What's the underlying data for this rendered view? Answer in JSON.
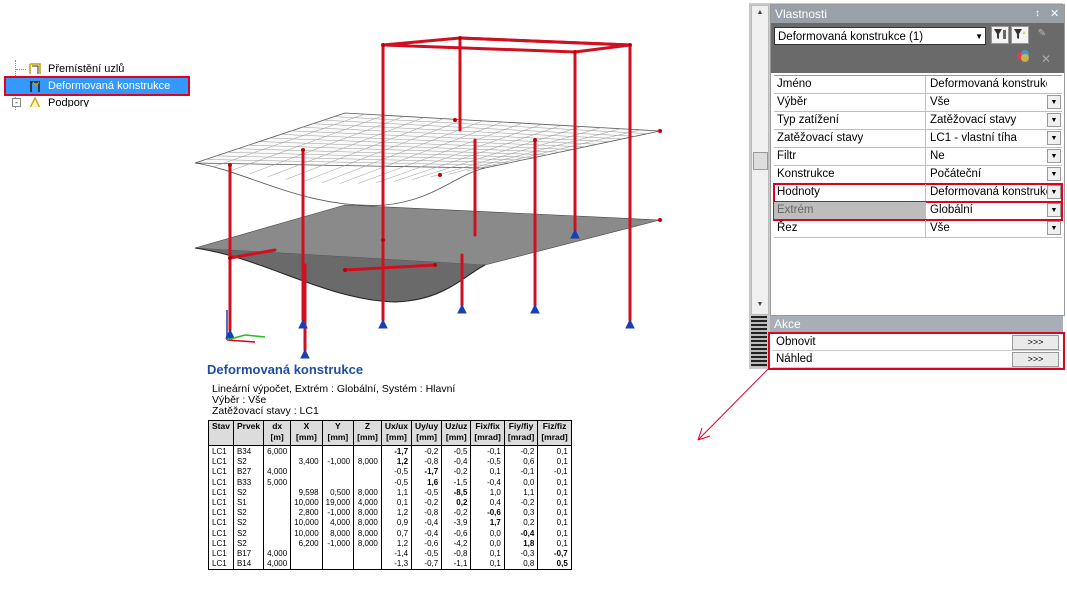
{
  "tree": {
    "items": [
      {
        "label": "Přemístění uzlů"
      },
      {
        "label": "Deformovaná konstrukce",
        "selected": true
      },
      {
        "label": "Podpory"
      }
    ]
  },
  "report": {
    "title": "Deformovaná konstrukce",
    "line1": "Lineární výpočet, Extrém : Globální, Systém : Hlavní",
    "line2": "Výběr : Vše",
    "line3": "Zatěžovací stavy : LC1",
    "columns": [
      {
        "name": "Stav",
        "unit": ""
      },
      {
        "name": "Prvek",
        "unit": ""
      },
      {
        "name": "dx",
        "unit": "[m]"
      },
      {
        "name": "X",
        "unit": "[mm]"
      },
      {
        "name": "Y",
        "unit": "[mm]"
      },
      {
        "name": "Z",
        "unit": "[mm]"
      },
      {
        "name": "Ux/ux",
        "unit": "[mm]"
      },
      {
        "name": "Uy/uy",
        "unit": "[mm]"
      },
      {
        "name": "Uz/uz",
        "unit": "[mm]"
      },
      {
        "name": "Fix/fix",
        "unit": "[mrad]"
      },
      {
        "name": "Fiy/fiy",
        "unit": "[mrad]"
      },
      {
        "name": "Fiz/fiz",
        "unit": "[mrad]"
      }
    ],
    "rows": [
      [
        "LC1",
        "B34",
        "6,000",
        "",
        "",
        "",
        "-1,7",
        "-0,2",
        "-0,5",
        "-0,1",
        "-0,2",
        "0,1"
      ],
      [
        "LC1",
        "S2",
        "",
        "3,400",
        "-1,000",
        "8,000",
        "1,2",
        "-0,8",
        "-0,4",
        "-0,5",
        "0,6",
        "0,1"
      ],
      [
        "LC1",
        "B27",
        "4,000",
        "",
        "",
        "",
        "-0,5",
        "-1,7",
        "-0,2",
        "0,1",
        "-0,1",
        "-0,1"
      ],
      [
        "LC1",
        "B33",
        "5,000",
        "",
        "",
        "",
        "-0,5",
        "1,6",
        "-1,5",
        "-0,4",
        "0,0",
        "0,1"
      ],
      [
        "LC1",
        "S2",
        "",
        "9,598",
        "0,500",
        "8,000",
        "1,1",
        "-0,5",
        "-8,5",
        "1,0",
        "1,1",
        "0,1"
      ],
      [
        "LC1",
        "S1",
        "",
        "10,000",
        "19,000",
        "4,000",
        "0,1",
        "-0,2",
        "0,2",
        "0,4",
        "-0,2",
        "0,1"
      ],
      [
        "LC1",
        "S2",
        "",
        "2,800",
        "-1,000",
        "8,000",
        "1,2",
        "-0,8",
        "-0,2",
        "-0,6",
        "0,3",
        "0,1"
      ],
      [
        "LC1",
        "S2",
        "",
        "10,000",
        "4,000",
        "8,000",
        "0,9",
        "-0,4",
        "-3,9",
        "1,7",
        "0,2",
        "0,1"
      ],
      [
        "LC1",
        "S2",
        "",
        "10,000",
        "8,000",
        "8,000",
        "0,7",
        "-0,4",
        "-0,6",
        "0,0",
        "-0,4",
        "0,1"
      ],
      [
        "LC1",
        "S2",
        "",
        "6,200",
        "-1,000",
        "8,000",
        "1,2",
        "-0,6",
        "-4,2",
        "0,0",
        "1,8",
        "0,1"
      ],
      [
        "LC1",
        "B17",
        "4,000",
        "",
        "",
        "",
        "-1,4",
        "-0,5",
        "-0,8",
        "0,1",
        "-0,3",
        "-0,7"
      ],
      [
        "LC1",
        "B14",
        "4,000",
        "",
        "",
        "",
        "-1,3",
        "-0,7",
        "-1,1",
        "0,1",
        "0,8",
        "0,5"
      ]
    ],
    "bold_cells": [
      [
        0,
        6
      ],
      [
        1,
        6
      ],
      [
        2,
        7
      ],
      [
        3,
        7
      ],
      [
        4,
        8
      ],
      [
        5,
        8
      ],
      [
        6,
        9
      ],
      [
        7,
        9
      ],
      [
        8,
        10
      ],
      [
        9,
        10
      ],
      [
        10,
        11
      ],
      [
        11,
        11
      ]
    ]
  },
  "properties": {
    "title": "Vlastnosti",
    "pin": "↕",
    "close": "✕",
    "selector": "Deformovaná konstrukce (1)",
    "rows": [
      {
        "key": "Jméno",
        "value": "Deformovaná konstrukce",
        "dropdown": false
      },
      {
        "key": "Výběr",
        "value": "Vše",
        "dropdown": true
      },
      {
        "key": "Typ zatížení",
        "value": "Zatěžovací stavy",
        "dropdown": true
      },
      {
        "key": "Zatěžovací stavy",
        "value": "LC1 - vlastní tíha",
        "dropdown": true
      },
      {
        "key": "Filtr",
        "value": "Ne",
        "dropdown": true
      },
      {
        "key": "Konstrukce",
        "value": "Počáteční",
        "dropdown": true
      },
      {
        "key": "Hodnoty",
        "value": "Deformovaná konstrukc",
        "dropdown": true,
        "highlight": true
      },
      {
        "key": "Extrém",
        "value": "Globální",
        "dropdown": true,
        "highlight": true,
        "grey": true
      },
      {
        "key": "Řez",
        "value": "Vše",
        "dropdown": true
      }
    ]
  },
  "actions": {
    "title": "Akce",
    "items": [
      {
        "label": "Obnovit",
        "button": ">>>"
      },
      {
        "label": "Náhled",
        "button": ">>>"
      }
    ]
  },
  "colors": {
    "highlight": "#e00020",
    "selection": "#3399ff",
    "title_blue": "#1f4fa0",
    "member_red": "#d01020",
    "support_blue": "#1a3fb0"
  }
}
